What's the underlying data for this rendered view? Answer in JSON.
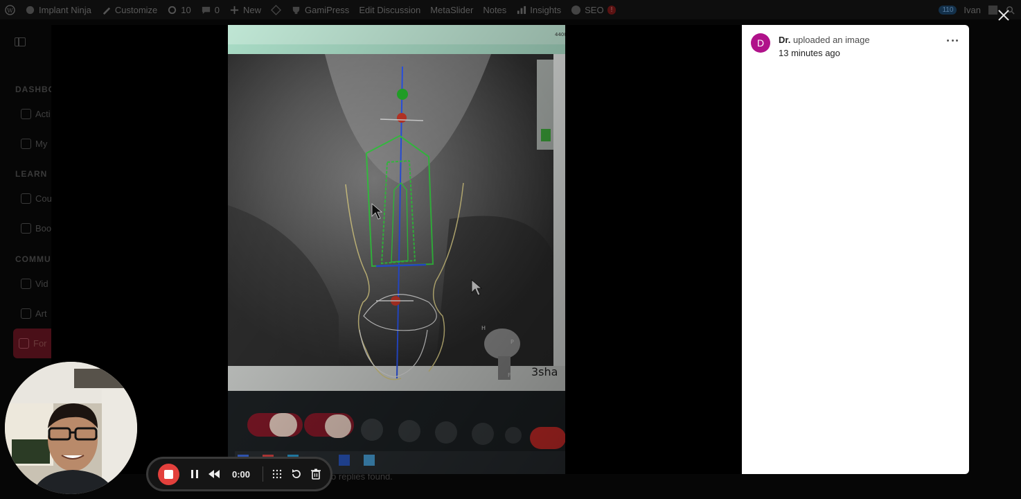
{
  "admin_bar": {
    "site_name": "Implant Ninja",
    "customize": "Customize",
    "updates_count": "10",
    "comments_count": "0",
    "new_label": "New",
    "gamipress": "GamiPress",
    "edit_discussion": "Edit Discussion",
    "metaslider": "MetaSlider",
    "notes": "Notes",
    "insights": "Insights",
    "seo": "SEO",
    "seo_badge": "!",
    "notif_count": "110",
    "user": "Ivan"
  },
  "sidebar": {
    "sections": [
      "DASHBOA",
      "LEARN",
      "COMMUN"
    ],
    "items": [
      "Acti",
      "My",
      "Cou",
      "Boo",
      "Vid",
      "Art",
      "For"
    ]
  },
  "background": {
    "replies_text": "o replies found."
  },
  "lightbox": {
    "author": "Dr.",
    "action": " uploaded an image",
    "time_ago": "13 minutes ago",
    "avatar_letter": "D",
    "photo_text": {
      "top_code": "4400",
      "brand_fragment": "3sha",
      "head_labels": [
        "H",
        "P",
        "F"
      ]
    }
  },
  "recorder": {
    "time": "0:00"
  },
  "colors": {
    "avatar": "#b0128a",
    "record": "#e3403c",
    "implant": "#3ddc4a",
    "axis": "#2e5bff"
  }
}
